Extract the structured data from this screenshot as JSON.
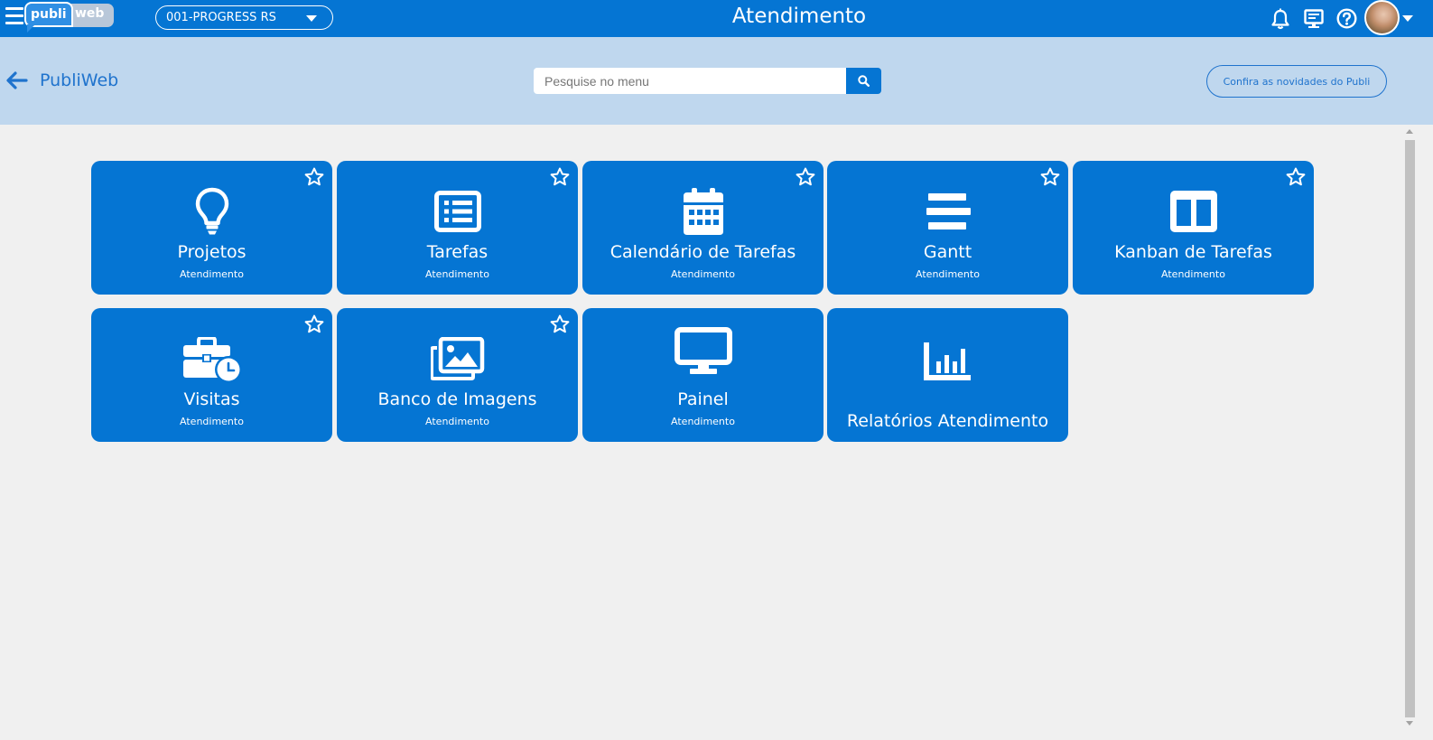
{
  "app": {
    "logo_left": "publi",
    "logo_right": "web",
    "unit_selector": "001-PROGRESS RS",
    "page_title": "Atendimento"
  },
  "icons": {
    "menu": "hamburger-icon",
    "notifications": "bell-icon",
    "screen": "presentation-icon",
    "help": "question-circle-icon",
    "back": "arrow-left-icon",
    "search": "search-icon",
    "favorite": "star-outline-icon"
  },
  "subheader": {
    "breadcrumb": "PubliWeb",
    "search_placeholder": "Pesquise no menu",
    "news_button": "Confira as novidades do Publi"
  },
  "colors": {
    "primary": "#0575d3",
    "subheader_bg": "#bfd7ee",
    "page_bg": "#f0f0f0"
  },
  "tiles": [
    {
      "title": "Projetos",
      "subtitle": "Atendimento",
      "icon": "lightbulb-icon",
      "favorite": false
    },
    {
      "title": "Tarefas",
      "subtitle": "Atendimento",
      "icon": "list-alt-icon",
      "favorite": false
    },
    {
      "title": "Calendário de Tarefas",
      "subtitle": "Atendimento",
      "icon": "calendar-icon",
      "favorite": false
    },
    {
      "title": "Gantt",
      "subtitle": "Atendimento",
      "icon": "gantt-icon",
      "favorite": false
    },
    {
      "title": "Kanban de Tarefas",
      "subtitle": "Atendimento",
      "icon": "columns-icon",
      "favorite": false
    },
    {
      "title": "Visitas",
      "subtitle": "Atendimento",
      "icon": "briefcase-clock-icon",
      "favorite": false
    },
    {
      "title": "Banco de Imagens",
      "subtitle": "Atendimento",
      "icon": "images-icon",
      "favorite": false
    },
    {
      "title": "Painel",
      "subtitle": "Atendimento",
      "icon": "desktop-icon"
    },
    {
      "title": "Relatórios Atendimento",
      "icon": "bar-chart-icon"
    }
  ]
}
